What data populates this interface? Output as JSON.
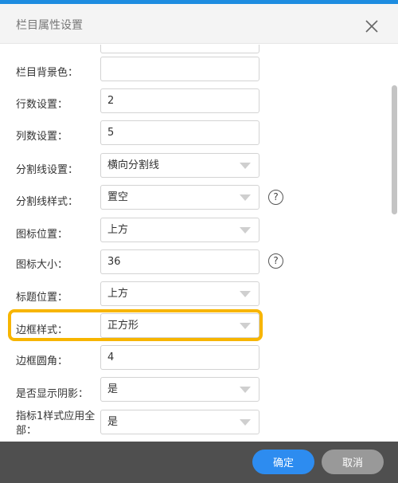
{
  "dialog": {
    "title": "栏目属性设置",
    "close_icon": "close-x"
  },
  "form": {
    "background_color": {
      "label": "栏目背景色：",
      "value": ""
    },
    "rows_setting": {
      "label": "行数设置：",
      "value": "2"
    },
    "cols_setting": {
      "label": "列数设置：",
      "value": "5"
    },
    "divider_setting": {
      "label": "分割线设置：",
      "value": "横向分割线"
    },
    "divider_style": {
      "label": "分割线样式：",
      "value": "置空",
      "help": "?"
    },
    "icon_position": {
      "label": "图标位置：",
      "value": "上方"
    },
    "icon_size": {
      "label": "图标大小：",
      "value": "36",
      "help": "?"
    },
    "title_position": {
      "label": "标题位置：",
      "value": "上方"
    },
    "border_style": {
      "label": "边框样式：",
      "value": "正方形"
    },
    "border_radius": {
      "label": "边框圆角：",
      "value": "4"
    },
    "show_shadow": {
      "label": "是否显示阴影：",
      "value": "是"
    },
    "indicator_apply_all": {
      "label": "指标1样式应用全部：",
      "value": "是"
    }
  },
  "footer": {
    "confirm_label": "确定",
    "cancel_label": "取消"
  },
  "colors": {
    "accent": "#2d8cf0",
    "highlight": "#f7b500",
    "footer_bg": "#4f4f4f"
  }
}
